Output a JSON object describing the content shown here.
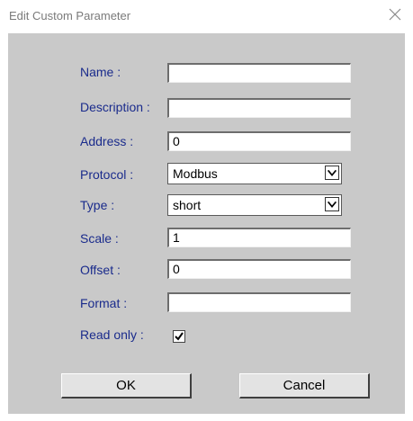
{
  "window": {
    "title": "Edit Custom Parameter"
  },
  "form": {
    "name": {
      "label": "Name :",
      "value": ""
    },
    "description": {
      "label": "Description :",
      "value": ""
    },
    "address": {
      "label": "Address :",
      "value": "0"
    },
    "protocol": {
      "label": "Protocol :",
      "value": "Modbus"
    },
    "type": {
      "label": "Type :",
      "value": "short"
    },
    "scale": {
      "label": "Scale :",
      "value": "1"
    },
    "offset": {
      "label": "Offset :",
      "value": "0"
    },
    "format": {
      "label": "Format :",
      "value": ""
    },
    "read_only": {
      "label": "Read only :",
      "checked": true
    }
  },
  "buttons": {
    "ok": "OK",
    "cancel": "Cancel"
  },
  "colors": {
    "panel_bg": "#c9c9c9",
    "label_text": "#1a2b8c",
    "title_text": "#7a7a7a"
  }
}
